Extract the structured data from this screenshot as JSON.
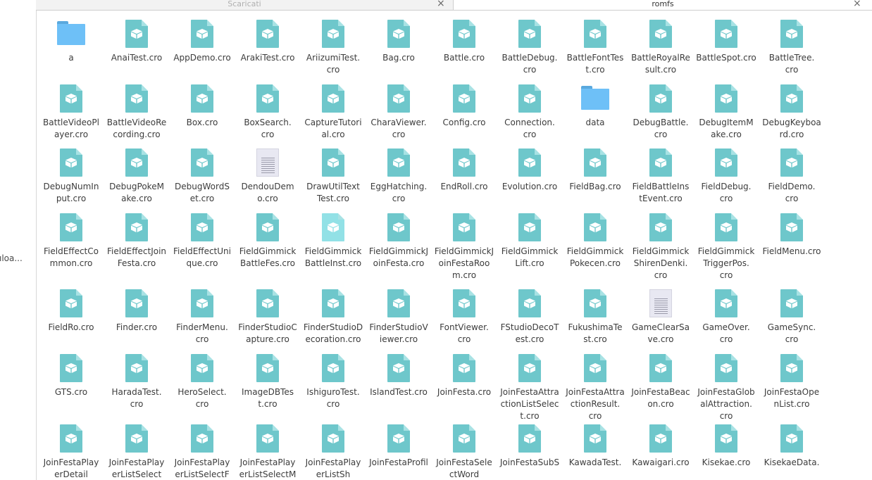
{
  "sidebar": {
    "item_label": "ıloa..."
  },
  "tabs": [
    {
      "title": "Scaricati",
      "close": "×",
      "active": false
    },
    {
      "title": "romfs",
      "close": "×",
      "active": true
    }
  ],
  "rows": [
    [
      {
        "kind": "folder",
        "label": "a"
      },
      {
        "kind": "cro",
        "label": "AnaiTest.cro"
      },
      {
        "kind": "cro",
        "label": "AppDemo.cro"
      },
      {
        "kind": "cro",
        "label": "ArakiTest.cro"
      },
      {
        "kind": "cro",
        "label": "AriizumiTest.\ncro"
      },
      {
        "kind": "cro",
        "label": "Bag.cro"
      },
      {
        "kind": "cro",
        "label": "Battle.cro"
      },
      {
        "kind": "cro",
        "label": "BattleDebug.\ncro"
      },
      {
        "kind": "cro",
        "label": "BattleFontTes\nt.cro"
      },
      {
        "kind": "cro",
        "label": "BattleRoyalRe\nsult.cro"
      },
      {
        "kind": "cro",
        "label": "BattleSpot.cro"
      },
      {
        "kind": "cro",
        "label": "BattleTree.\ncro"
      }
    ],
    [
      {
        "kind": "cro",
        "label": "BattleVideoPl\nayer.cro"
      },
      {
        "kind": "cro",
        "label": "BattleVideoRe\ncording.cro"
      },
      {
        "kind": "cro",
        "label": "Box.cro"
      },
      {
        "kind": "cro",
        "label": "BoxSearch.\ncro"
      },
      {
        "kind": "cro",
        "label": "CaptureTutori\nal.cro"
      },
      {
        "kind": "cro",
        "label": "CharaViewer.\ncro"
      },
      {
        "kind": "cro",
        "label": "Config.cro"
      },
      {
        "kind": "cro",
        "label": "Connection.\ncro"
      },
      {
        "kind": "folder",
        "label": "data"
      },
      {
        "kind": "cro",
        "label": "DebugBattle.\ncro"
      },
      {
        "kind": "cro",
        "label": "DebugItemM\nake.cro"
      },
      {
        "kind": "cro",
        "label": "DebugKeyboa\nrd.cro"
      }
    ],
    [
      {
        "kind": "cro",
        "label": "DebugNumIn\nput.cro"
      },
      {
        "kind": "cro",
        "label": "DebugPokeM\nake.cro"
      },
      {
        "kind": "cro",
        "label": "DebugWordS\net.cro"
      },
      {
        "kind": "text",
        "label": "DendouDem\no.cro"
      },
      {
        "kind": "cro",
        "label": "DrawUtilText\nTest.cro"
      },
      {
        "kind": "cro",
        "label": "EggHatching.\ncro"
      },
      {
        "kind": "cro",
        "label": "EndRoll.cro"
      },
      {
        "kind": "cro",
        "label": "Evolution.cro"
      },
      {
        "kind": "cro",
        "label": "FieldBag.cro"
      },
      {
        "kind": "cro",
        "label": "FieldBattleIns\ntEvent.cro"
      },
      {
        "kind": "cro",
        "label": "FieldDebug.\ncro"
      },
      {
        "kind": "cro",
        "label": "FieldDemo.\ncro"
      }
    ],
    [
      {
        "kind": "cro",
        "label": "FieldEffectCo\nmmon.cro"
      },
      {
        "kind": "cro",
        "label": "FieldEffectJoin\nFesta.cro"
      },
      {
        "kind": "cro",
        "label": "FieldEffectUni\nque.cro"
      },
      {
        "kind": "cro",
        "label": "FieldGimmick\nBattleFes.cro"
      },
      {
        "kind": "cro-light",
        "label": "FieldGimmick\nBattleInst.cro"
      },
      {
        "kind": "cro",
        "label": "FieldGimmickJ\noinFesta.cro"
      },
      {
        "kind": "cro",
        "label": "FieldGimmickJ\noinFestaRoo\nm.cro"
      },
      {
        "kind": "cro",
        "label": "FieldGimmick\nLift.cro"
      },
      {
        "kind": "cro",
        "label": "FieldGimmick\nPokecen.cro"
      },
      {
        "kind": "cro",
        "label": "FieldGimmick\nShirenDenki.\ncro"
      },
      {
        "kind": "cro",
        "label": "FieldGimmick\nTriggerPos.\ncro"
      },
      {
        "kind": "cro",
        "label": "FieldMenu.cro"
      }
    ],
    [
      {
        "kind": "cro",
        "label": "FieldRo.cro"
      },
      {
        "kind": "cro",
        "label": "Finder.cro"
      },
      {
        "kind": "cro",
        "label": "FinderMenu.\ncro"
      },
      {
        "kind": "cro",
        "label": "FinderStudioC\napture.cro"
      },
      {
        "kind": "cro",
        "label": "FinderStudioD\necoration.cro"
      },
      {
        "kind": "cro",
        "label": "FinderStudioV\niewer.cro"
      },
      {
        "kind": "cro",
        "label": "FontViewer.\ncro"
      },
      {
        "kind": "cro",
        "label": "FStudioDecoT\nest.cro"
      },
      {
        "kind": "cro",
        "label": "FukushimaTe\nst.cro"
      },
      {
        "kind": "text",
        "label": "GameClearSa\nve.cro"
      },
      {
        "kind": "cro",
        "label": "GameOver.\ncro"
      },
      {
        "kind": "cro",
        "label": "GameSync.\ncro"
      }
    ],
    [
      {
        "kind": "cro",
        "label": "GTS.cro"
      },
      {
        "kind": "cro",
        "label": "HaradaTest.\ncro"
      },
      {
        "kind": "cro",
        "label": "HeroSelect.\ncro"
      },
      {
        "kind": "cro",
        "label": "ImageDBTes\nt.cro"
      },
      {
        "kind": "cro",
        "label": "IshiguroTest.\ncro"
      },
      {
        "kind": "cro",
        "label": "IslandTest.cro"
      },
      {
        "kind": "cro",
        "label": "JoinFesta.cro"
      },
      {
        "kind": "cro",
        "label": "JoinFestaAttra\nctionListSelec\nt.cro"
      },
      {
        "kind": "cro",
        "label": "JoinFestaAttra\nctionResult.\ncro"
      },
      {
        "kind": "cro",
        "label": "JoinFestaBeac\non.cro"
      },
      {
        "kind": "cro",
        "label": "JoinFestaGlob\nalAttraction.\ncro"
      },
      {
        "kind": "cro",
        "label": "JoinFestaOpe\nnList.cro"
      }
    ],
    [
      {
        "kind": "cro",
        "label": "JoinFestaPlay\nerDetail"
      },
      {
        "kind": "cro",
        "label": "JoinFestaPlay\nerListSelect"
      },
      {
        "kind": "cro",
        "label": "JoinFestaPlay\nerListSelectF"
      },
      {
        "kind": "cro",
        "label": "JoinFestaPlay\nerListSelectM"
      },
      {
        "kind": "cro",
        "label": "JoinFestaPlay\nerListSh"
      },
      {
        "kind": "cro",
        "label": "JoinFestaProfil"
      },
      {
        "kind": "cro",
        "label": "JoinFestaSele\nctWord"
      },
      {
        "kind": "cro",
        "label": "JoinFestaSubS"
      },
      {
        "kind": "cro",
        "label": "KawadaTest."
      },
      {
        "kind": "cro",
        "label": "Kawaigari.cro"
      },
      {
        "kind": "cro",
        "label": "Kisekae.cro"
      },
      {
        "kind": "cro",
        "label": "KisekaeData."
      }
    ]
  ]
}
